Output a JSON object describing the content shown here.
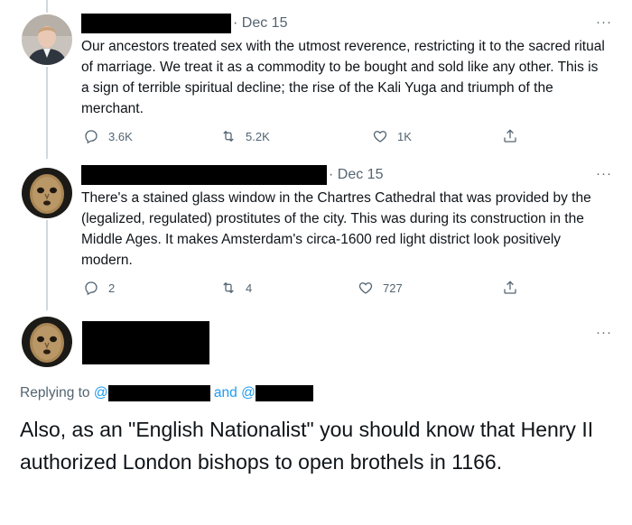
{
  "tweets": [
    {
      "date": "Dec 15",
      "text": "Our ancestors treated sex with the utmost reverence, restricting it to the sacred ritual of marriage. We treat it as a commodity to be bought and sold like any other. This is a sign of terrible spiritual decline; the rise of the Kali Yuga and triumph of the merchant.",
      "replies": "3.6K",
      "retweets": "5.2K",
      "likes": "1K"
    },
    {
      "date": "Dec 15",
      "text": "There's a stained glass window in the Chartres Cathedral that was provided by the (legalized, regulated) prostitutes of the city. This was during its construction in the Middle Ages. It makes Amsterdam's circa-1600 red light district look positively modern.",
      "replies": "2",
      "retweets": "4",
      "likes": "727"
    }
  ],
  "main_tweet": {
    "replying_to_label": "Replying to",
    "at_sign": "@",
    "and_label": "and",
    "text": "Also, as an \"English Nationalist\" you should know that Henry II authorized London bishops to open brothels in 1166."
  },
  "more_icon": "···",
  "icons": [
    "reply-icon",
    "retweet-icon",
    "like-icon",
    "share-icon",
    "more-icon"
  ],
  "colors": {
    "link": "#1d9bf0",
    "secondary_text": "#536471",
    "redaction": "#000000"
  }
}
